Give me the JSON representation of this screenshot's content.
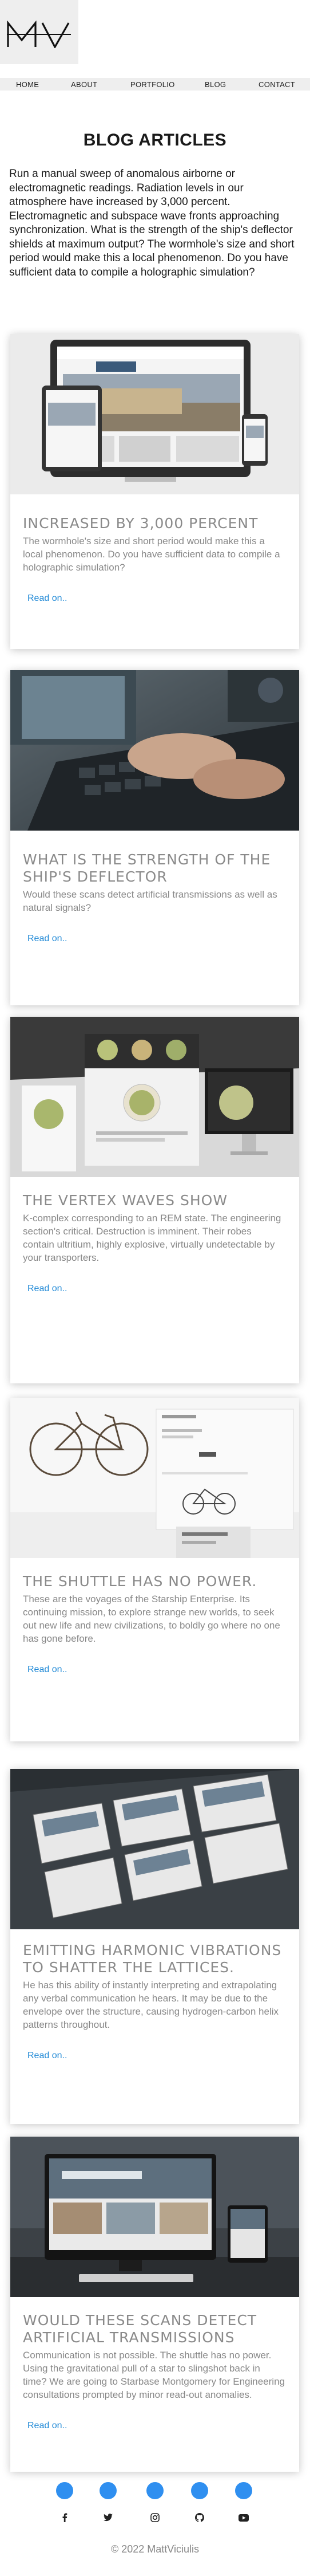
{
  "brand": {
    "logo_text": "MV"
  },
  "nav": {
    "items": [
      "HOME",
      "ABOUT",
      "PORTFOLIO",
      "BLOG",
      "CONTACT"
    ]
  },
  "page": {
    "title": "BLOG ARTICLES",
    "intro": "Run a manual sweep of anomalous airborne or electromagnetic readings. Radiation levels in our atmosphere have increased by 3,000 percent. Electromagnetic and subspace wave fronts approaching synchronization. What is the strength of the ship's deflector shields at maximum output? The wormhole's size and short period would make this a local phenomenon. Do you have sufficient data to compile a holographic simulation?"
  },
  "articles": [
    {
      "title": "INCREASED BY 3,000 PERCENT",
      "text": "The wormhole's size and short period would make this a local phenomenon. Do you have sufficient data to compile a holographic simulation?",
      "link": "Read on..",
      "image": "devices-museum-website"
    },
    {
      "title": "WHAT IS THE STRENGTH OF THE SHIP'S DEFLECTOR",
      "text": "Would these scans detect artificial transmissions as well as natural signals?",
      "link": "Read on..",
      "image": "laptop-typing"
    },
    {
      "title": "THE VERTEX WAVES SHOW",
      "text": "K-complex corresponding to an REM state. The engineering section's critical. Destruction is imminent. Their robes contain ultritium, highly explosive, virtually undetectable by your transporters.",
      "link": "Read on..",
      "image": "restaurant-website-mockup"
    },
    {
      "title": "THE SHUTTLE HAS NO POWER.",
      "text": "These are the voyages of the Starship Enterprise. Its continuing mission, to explore strange new worlds, to seek out new life and new civilizations, to boldly go where no one has gone before.",
      "link": "Read on..",
      "image": "bicycle-shop-website"
    },
    {
      "title": "EMITTING HARMONIC VIBRATIONS TO SHATTER THE LATTICES.",
      "text": "He has this ability of instantly interpreting and extrapolating any verbal communication he hears. It may be due to the envelope over the structure, causing hydrogen-carbon helix patterns throughout.",
      "link": "Read on..",
      "image": "website-pages-perspective"
    },
    {
      "title": "WOULD THESE SCANS DETECT ARTIFICIAL TRANSMISSIONS",
      "text": "Communication is not possible. The shuttle has no power. Using the gravitational pull of a star to slingshot back in time? We are going to Starbase Montgomery for Engineering consultations prompted by minor read-out anomalies.",
      "link": "Read on..",
      "image": "hotel-website-desktop"
    }
  ],
  "footer": {
    "dots": 5,
    "socials": [
      "facebook-icon",
      "twitter-icon",
      "instagram-icon",
      "github-icon",
      "youtube-icon"
    ],
    "copyright": "© 2022 MattViciulis"
  },
  "colors": {
    "accent": "#2f8ff0",
    "link": "#1e88d6",
    "muted": "#888888",
    "nav_bg": "#eeeeee"
  }
}
